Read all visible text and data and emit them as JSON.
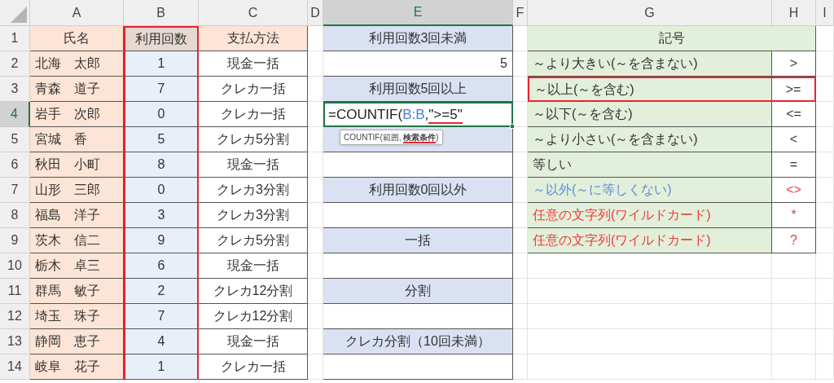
{
  "columns": [
    {
      "label": "A",
      "selected": false
    },
    {
      "label": "B",
      "selected": false
    },
    {
      "label": "C",
      "selected": false
    },
    {
      "label": "D",
      "selected": false
    },
    {
      "label": "E",
      "selected": true
    },
    {
      "label": "F",
      "selected": false
    },
    {
      "label": "G",
      "selected": false
    },
    {
      "label": "H",
      "selected": false
    },
    {
      "label": "I",
      "selected": false
    }
  ],
  "row_headers": [
    {
      "label": "1",
      "selected": false
    },
    {
      "label": "2",
      "selected": false
    },
    {
      "label": "3",
      "selected": false
    },
    {
      "label": "4",
      "selected": true
    },
    {
      "label": "5",
      "selected": false
    },
    {
      "label": "6",
      "selected": false
    },
    {
      "label": "7",
      "selected": false
    },
    {
      "label": "8",
      "selected": false
    },
    {
      "label": "9",
      "selected": false
    },
    {
      "label": "10",
      "selected": false
    },
    {
      "label": "11",
      "selected": false
    },
    {
      "label": "12",
      "selected": false
    },
    {
      "label": "13",
      "selected": false
    },
    {
      "label": "14",
      "selected": false
    }
  ],
  "customer_table": {
    "headers": [
      {
        "text": "氏名",
        "highlighted": false
      },
      {
        "text": "利用回数",
        "highlighted": true
      },
      {
        "text": "支払方法",
        "highlighted": false
      }
    ],
    "rows": [
      {
        "name": "北海　太郎",
        "count": "1",
        "payment": "現金一括"
      },
      {
        "name": "青森　道子",
        "count": "7",
        "payment": "クレカ一括"
      },
      {
        "name": "岩手　次郎",
        "count": "0",
        "payment": "クレカ一括"
      },
      {
        "name": "宮城　香",
        "count": "5",
        "payment": "クレカ5分割"
      },
      {
        "name": "秋田　小町",
        "count": "8",
        "payment": "現金一括"
      },
      {
        "name": "山形　三郎",
        "count": "0",
        "payment": "クレカ3分割"
      },
      {
        "name": "福島　洋子",
        "count": "3",
        "payment": "クレカ3分割"
      },
      {
        "name": "茨木　信二",
        "count": "9",
        "payment": "クレカ5分割"
      },
      {
        "name": "栃木　卓三",
        "count": "6",
        "payment": "現金一括"
      },
      {
        "name": "群馬　敏子",
        "count": "2",
        "payment": "クレカ12分割"
      },
      {
        "name": "埼玉　珠子",
        "count": "7",
        "payment": "クレカ12分割"
      },
      {
        "name": "静岡　恵子",
        "count": "4",
        "payment": "現金一括"
      },
      {
        "name": "岐阜　花子",
        "count": "1",
        "payment": "クレカ一括"
      }
    ]
  },
  "count_column": [
    {
      "kind": "label",
      "text": "利用回数3回未満",
      "selected": false
    },
    {
      "kind": "value",
      "text": "5",
      "selected": false
    },
    {
      "kind": "label",
      "text": "利用回数5回以上",
      "selected": false
    },
    {
      "kind": "formula",
      "selected": true,
      "parts": [
        {
          "kind": "text",
          "text": "=COUNTIF(",
          "underlined": false
        },
        {
          "kind": "reference",
          "text": "B:B",
          "underlined": false
        },
        {
          "kind": "text",
          "text": ",",
          "underlined": false
        },
        {
          "kind": "text",
          "text": "\">=5\"",
          "underlined": true
        }
      ],
      "tooltip": "COUNTIF(範囲, **検索条件**)"
    },
    {
      "kind": "label",
      "selected": false
    },
    {
      "kind": "value",
      "selected": false
    },
    {
      "kind": "label",
      "text": "利用回数0回以外",
      "selected": false
    },
    {
      "kind": "value",
      "selected": false
    },
    {
      "kind": "label",
      "text": "一括",
      "selected": false
    },
    {
      "kind": "value",
      "selected": false
    },
    {
      "kind": "label",
      "text": "分割",
      "selected": false
    },
    {
      "kind": "value",
      "selected": false
    },
    {
      "kind": "label",
      "text": "クレカ分割（10回未満）",
      "selected": false
    },
    {
      "kind": "value",
      "selected": false
    }
  ],
  "symbol_table": {
    "title": "記号",
    "rows": [
      {
        "label": "～より大きい(～を含まない)",
        "color": "#333333",
        "highlighted": false,
        "symbol": {
          "text": ">",
          "color": "#333333"
        }
      },
      {
        "label": "～以上(～を含む)",
        "color": "#333333",
        "highlighted": true,
        "symbol": {
          "text": ">=",
          "color": "#333333"
        }
      },
      {
        "label": "～以下(～を含む)",
        "color": "#333333",
        "highlighted": false,
        "symbol": {
          "text": "<=",
          "color": "#333333"
        }
      },
      {
        "label": "～より小さい(～を含まない)",
        "color": "#333333",
        "highlighted": false,
        "symbol": {
          "text": "<",
          "color": "#333333"
        }
      },
      {
        "label": "等しい",
        "color": "#333333",
        "highlighted": false,
        "symbol": {
          "text": "=",
          "color": "#333333"
        }
      },
      {
        "label": "～以外(～に等しくない)",
        "color": "#5b8fd6",
        "highlighted": false,
        "symbol": {
          "text": "<>",
          "color": "#ee3b3b"
        }
      },
      {
        "label": "任意の文字列(ワイルドカード)",
        "color": "#ee3b3b",
        "highlighted": false,
        "symbol": {
          "text": "*",
          "color": "#ee3b3b"
        }
      },
      {
        "label": "任意の文字列(ワイルドカード)",
        "color": "#ee3b3b",
        "highlighted": false,
        "symbol": {
          "text": "?",
          "color": "#ee3b3b"
        }
      }
    ]
  }
}
